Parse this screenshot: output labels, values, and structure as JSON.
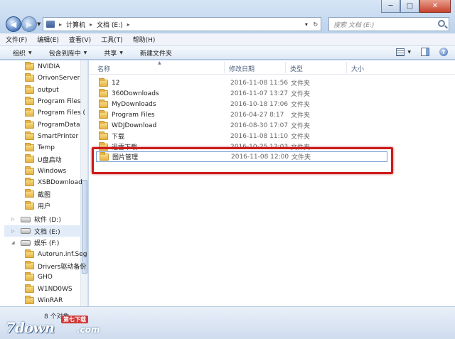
{
  "window": {
    "minimize": "─",
    "maximize": "□",
    "close": "✕"
  },
  "address": {
    "segments": [
      "计算机",
      "文档 (E:)"
    ],
    "search_placeholder": "搜索 文档 (E:)"
  },
  "menu": [
    "文件(F)",
    "编辑(E)",
    "查看(V)",
    "工具(T)",
    "帮助(H)"
  ],
  "toolbar": {
    "organize": "组织",
    "include": "包含到库中",
    "share": "共享",
    "new_folder": "新建文件夹",
    "help": "?"
  },
  "nav": {
    "folders": [
      "NVIDIA",
      "OrivonServer",
      "output",
      "Program Files",
      "Program Files (",
      "ProgramData",
      "SmartPrinter",
      "Temp",
      "U盘启动",
      "Windows",
      "XSBDownload",
      "截图",
      "用户"
    ],
    "drives": [
      "软件 (D:)",
      "文档 (E:)",
      "娱乐 (F:)"
    ],
    "sub_items": [
      "Autorun.inf.Seg",
      "Drivers驱动备份",
      "GHO",
      "W1ND0WS",
      "WinRAR"
    ]
  },
  "columns": {
    "name": "名称",
    "date": "修改日期",
    "type": "类型",
    "size": "大小"
  },
  "files": [
    {
      "name": "12",
      "date": "2016-11-08 11:56",
      "type": "文件夹"
    },
    {
      "name": "360Downloads",
      "date": "2016-11-07 13:27",
      "type": "文件夹"
    },
    {
      "name": "MyDownloads",
      "date": "2016-10-18 17:06",
      "type": "文件夹"
    },
    {
      "name": "Program Files",
      "date": "2016-04-27 8:17",
      "type": "文件夹"
    },
    {
      "name": "WDJDownload",
      "date": "2016-08-30 17:07",
      "type": "文件夹"
    },
    {
      "name": "下载",
      "date": "2016-11-08 11:10",
      "type": "文件夹"
    },
    {
      "name": "迅雷下载",
      "date": "2016-10-25 12:03",
      "type": "文件夹"
    },
    {
      "name": "图片管理",
      "date": "2016-11-08 12:00",
      "type": "文件夹"
    }
  ],
  "status": {
    "count": "8 个对象"
  },
  "watermark": {
    "logo": "7down",
    "badge": "第七下载",
    "suffix": ".com"
  },
  "colors": {
    "highlight": "#cc1b1b",
    "selection": "#7aa1d2"
  }
}
